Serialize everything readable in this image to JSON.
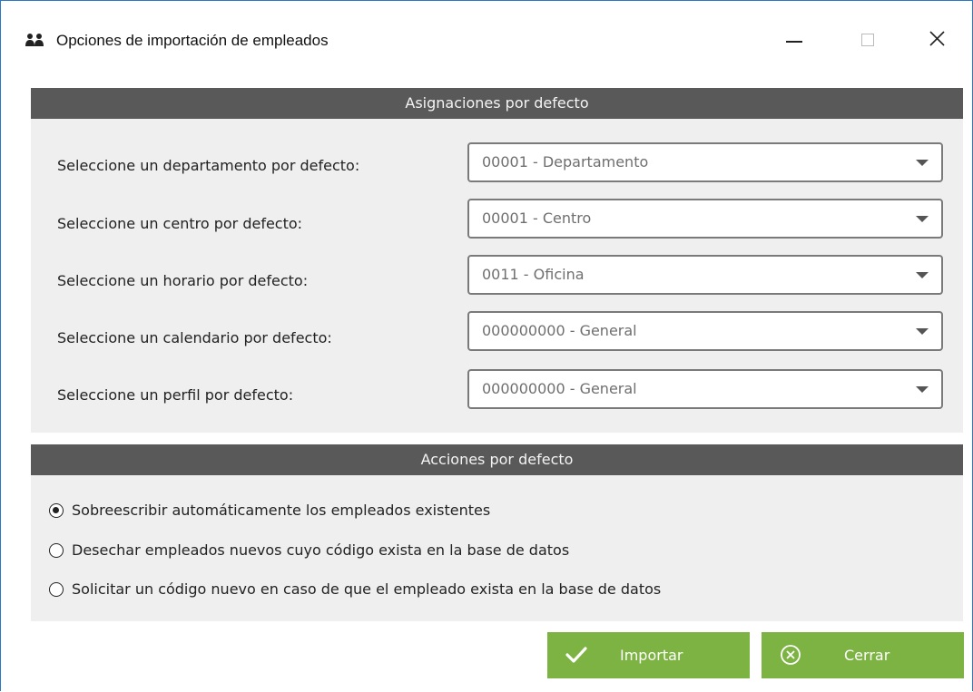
{
  "window": {
    "title": "Opciones de importación de empleados",
    "icon": "users-icon"
  },
  "assignments": {
    "header": "Asignaciones por defecto",
    "rows": [
      {
        "label": "Seleccione un departamento por defecto:",
        "value": "00001 - Departamento"
      },
      {
        "label": "Seleccione un centro por defecto:",
        "value": "00001 - Centro"
      },
      {
        "label": "Seleccione un horario por defecto:",
        "value": "0011 - Oficina"
      },
      {
        "label": "Seleccione un calendario por defecto:",
        "value": "000000000 - General"
      },
      {
        "label": "Seleccione un perfil por defecto:",
        "value": "000000000 - General"
      }
    ]
  },
  "actions": {
    "header": "Acciones por defecto",
    "options": [
      {
        "label": "Sobreescribir automáticamente los empleados existentes",
        "checked": true
      },
      {
        "label": "Desechar empleados nuevos cuyo código exista en la base de datos",
        "checked": false
      },
      {
        "label": "Solicitar un código nuevo en caso de que el empleado exista en la base de datos",
        "checked": false
      }
    ]
  },
  "buttons": {
    "import_label": "Importar",
    "close_label": "Cerrar"
  },
  "colors": {
    "accent_green": "#7cb342",
    "header_gray": "#595959",
    "panel_bg": "#efefef",
    "window_border": "#2b79c2"
  }
}
